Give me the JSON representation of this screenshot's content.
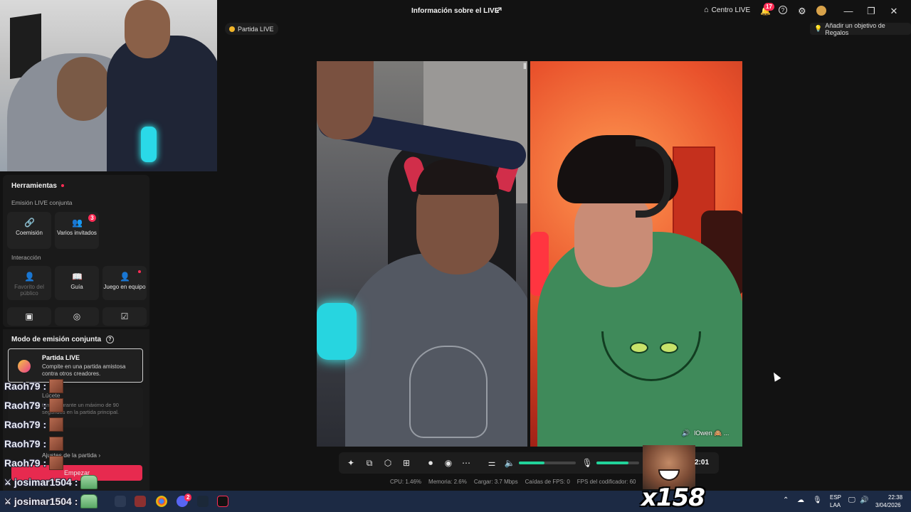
{
  "window": {
    "title": "Información sobre el LIVE",
    "centro_live": "Centro LIVE",
    "notifications_count": "17",
    "controls": {
      "minimize": "—",
      "maximize": "❐",
      "close": "✕"
    }
  },
  "top_row": {
    "partida_pill": "Partida LIVE",
    "regalos": "Añadir un objetivo de Regalos"
  },
  "panel": {
    "herramientas": "Herramientas",
    "emision_conjunta": "Emisión LIVE conjunta",
    "tiles_emision": [
      {
        "label": "Coemisión",
        "icon": "link-icon"
      },
      {
        "label": "Varios invitados",
        "icon": "guests-icon",
        "badge": "3"
      }
    ],
    "interaccion": "Interacción",
    "tiles_interaccion": [
      {
        "label": "Favorito del público",
        "icon": "favorite-icon",
        "disabled": true
      },
      {
        "label": "Guía",
        "icon": "guide-icon"
      },
      {
        "label": "Juego en equipo",
        "icon": "team-icon",
        "dot": true
      }
    ]
  },
  "modo": {
    "title": "Modo de emisión conjunta",
    "card_title": "Partida LIVE",
    "card_desc": "Compite en una partida amistosa contra otros creadores.",
    "lucete": "Lúcete",
    "lucete_desc": "turnos durante un máximo de 90 segundos en la partida principal.",
    "ajustes": "Ajustes de la partida",
    "empezar": "Empezar"
  },
  "chat": [
    {
      "user": "Raoh79 :",
      "emote": "emote-face"
    },
    {
      "user": "Raoh79 :",
      "emote": "emote-face"
    },
    {
      "user": "Raoh79 :",
      "emote": "emote-face"
    },
    {
      "user": "Raoh79 :",
      "emote": "emote-face"
    },
    {
      "user": "Raoh79 :",
      "emote": "emote-face"
    },
    {
      "user": "josimar1504 :",
      "emote": "emote-pepe"
    },
    {
      "user": "josimar1504 :",
      "emote": "emote-pepe"
    }
  ],
  "video": {
    "guest_name": "lOwen 🙈 ..."
  },
  "controls_bar": {
    "volume_level": 0.45,
    "mic_level": 0.75,
    "timer": "2:01"
  },
  "stats": {
    "cpu": "CPU:  1.46%",
    "memoria": "Memoria:  2.6%",
    "cargar": "Cargar:  3.7 Mbps",
    "caidas": "Caídas de FPS:  0",
    "fps": "FPS del codificador:  60"
  },
  "overlay": {
    "combo": "x158"
  },
  "taskbar": {
    "lang_top": "ESP",
    "lang_bottom": "LAA",
    "time": "22:38",
    "date": "3/04/2026",
    "discord_badge": "2"
  },
  "colors": {
    "accent": "#fe2c55",
    "slider": "#22d39a",
    "taskbar": "#1c2a44"
  }
}
